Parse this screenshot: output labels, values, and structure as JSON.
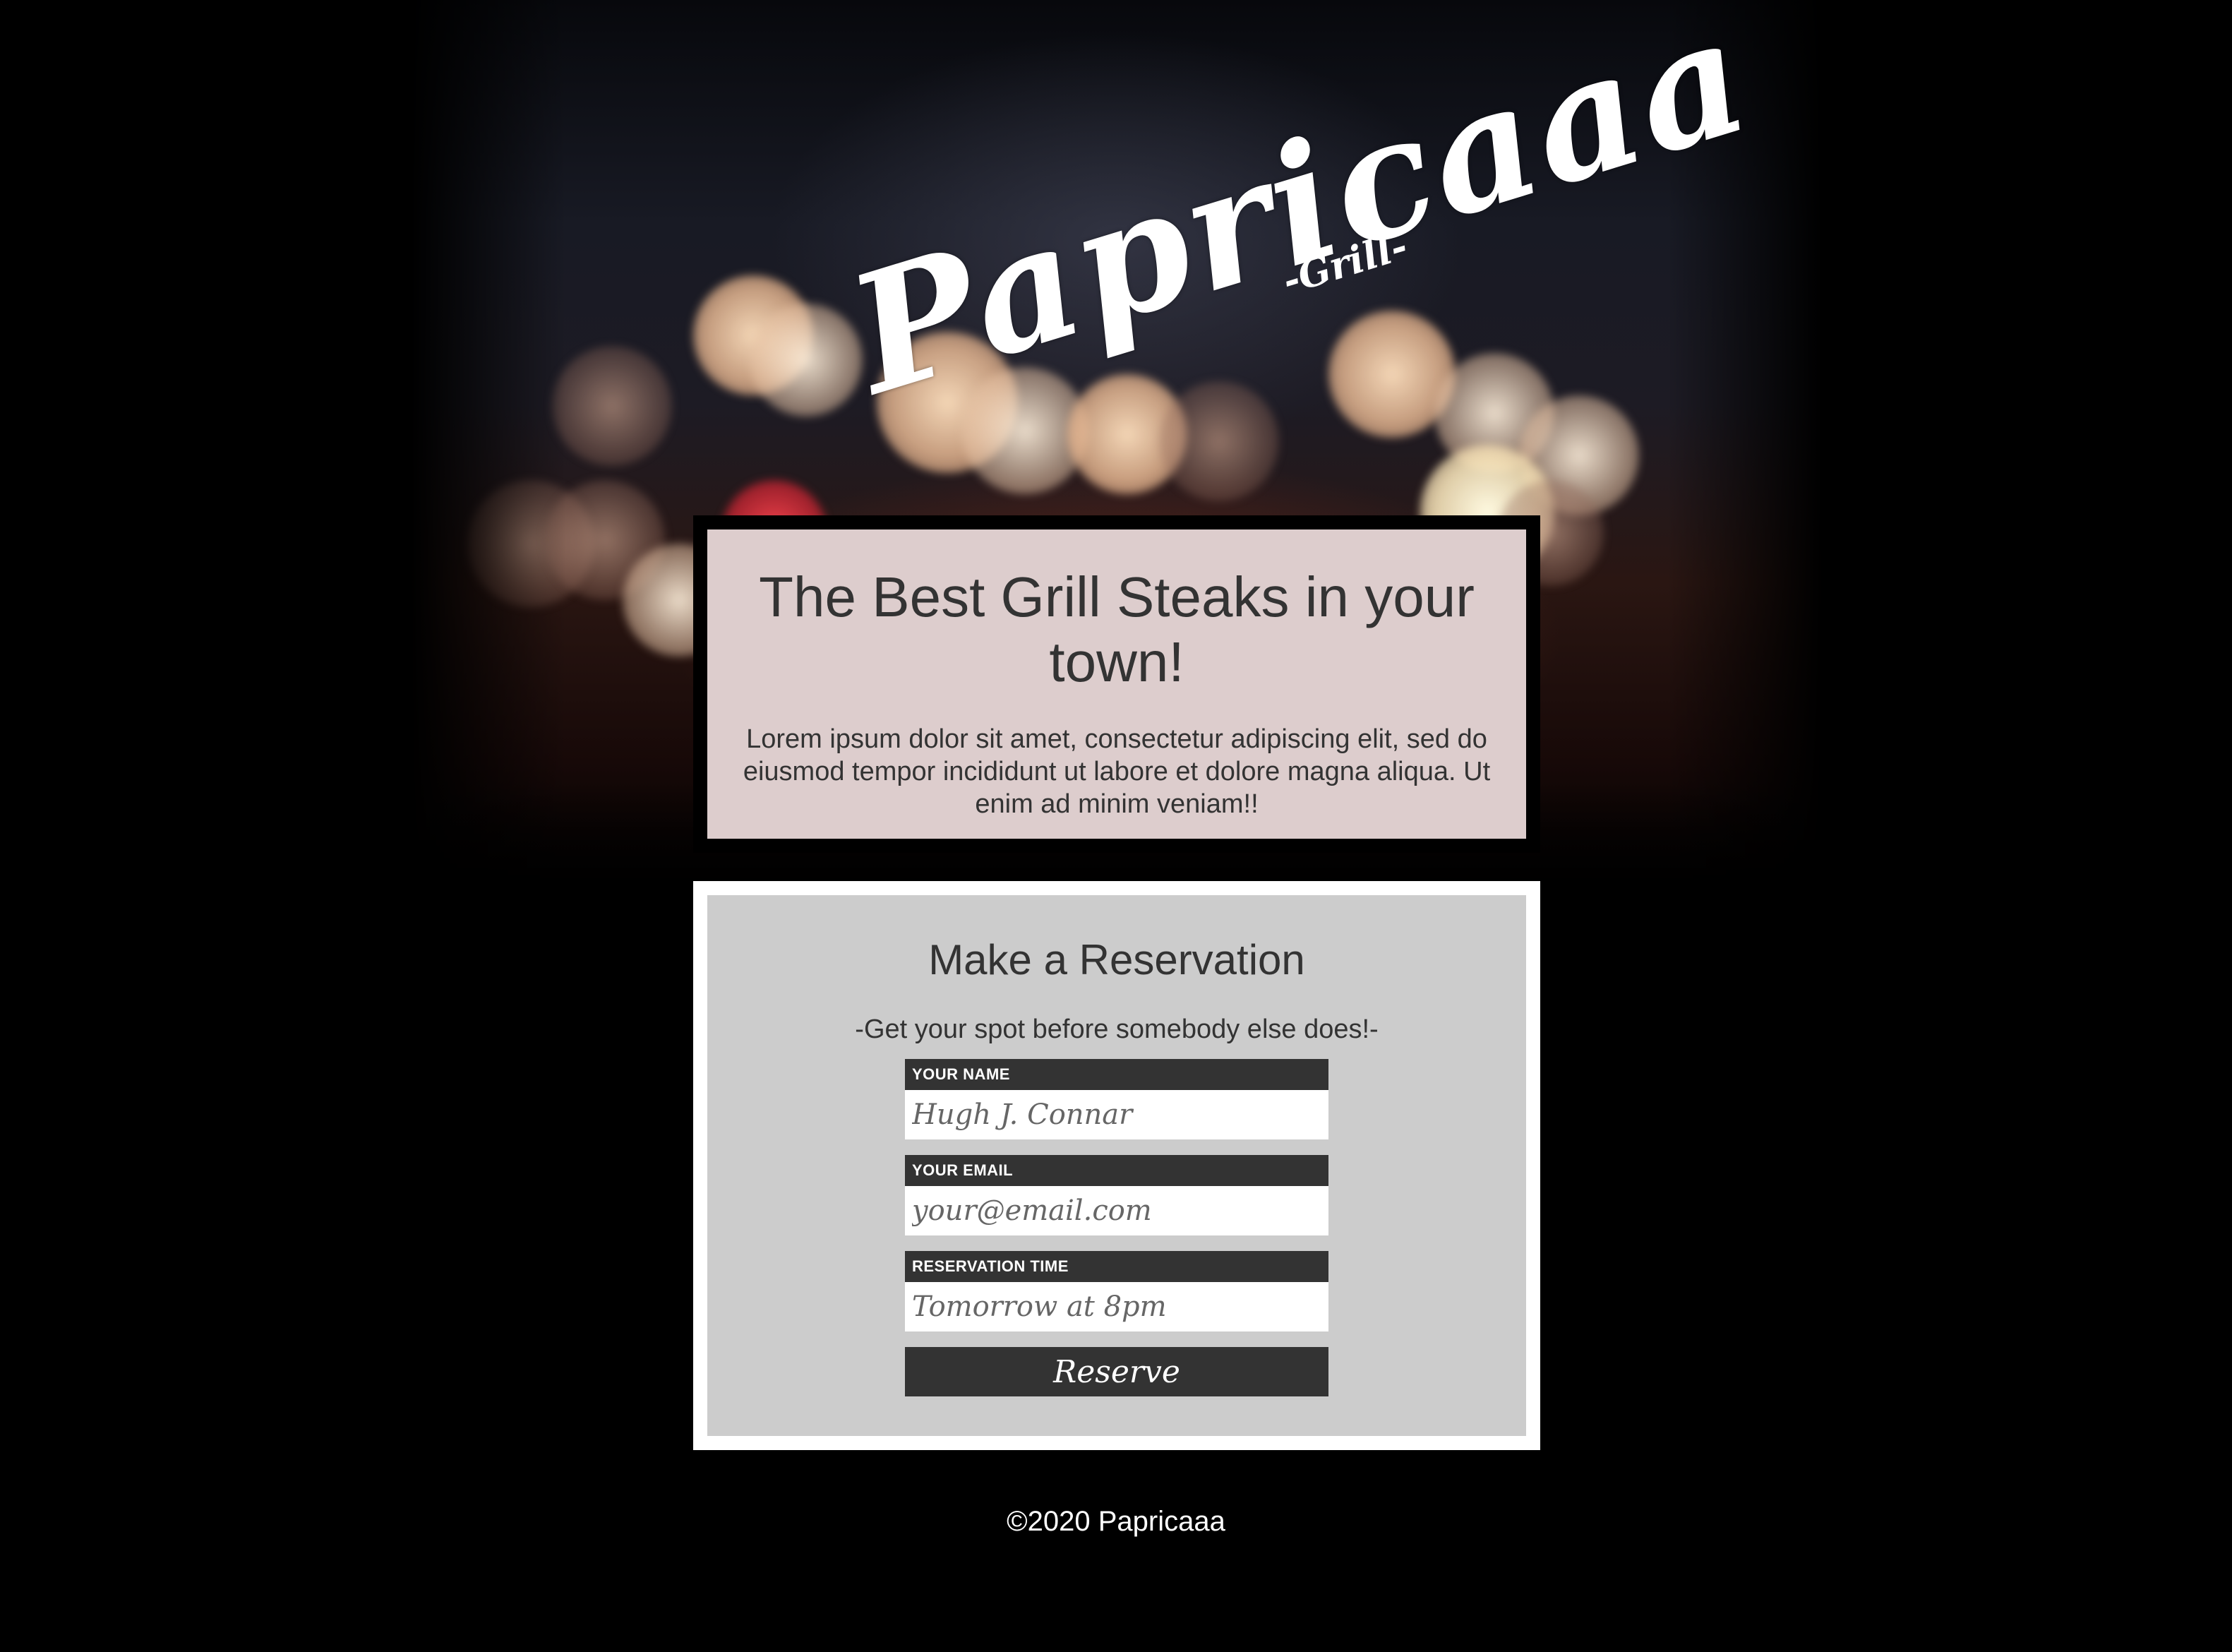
{
  "hero": {
    "logo_main": "Papricaaa",
    "logo_sub": "-Grill-"
  },
  "intro": {
    "title": "The Best Grill Steaks in your town!",
    "text": "Lorem ipsum dolor sit amet, consectetur adipiscing elit, sed do eiusmod tempor incididunt ut labore et dolore magna aliqua. Ut enim ad minim veniam!!"
  },
  "reservation": {
    "title": "Make a Reservation",
    "subtitle": "-Get your spot before somebody else does!-",
    "fields": [
      {
        "label": "YOUR NAME",
        "placeholder": "Hugh J. Connar"
      },
      {
        "label": "YOUR EMAIL",
        "placeholder": "your@email.com"
      },
      {
        "label": "RESERVATION TIME",
        "placeholder": "Tomorrow at 8pm"
      }
    ],
    "submit_label": "Reserve"
  },
  "footer": {
    "copyright": "©2020 Papricaaa"
  },
  "colors": {
    "background": "#000000",
    "intro_panel": "#f0dede",
    "form_panel": "#cccccc",
    "label_bg": "#333333",
    "text": "#333333"
  }
}
